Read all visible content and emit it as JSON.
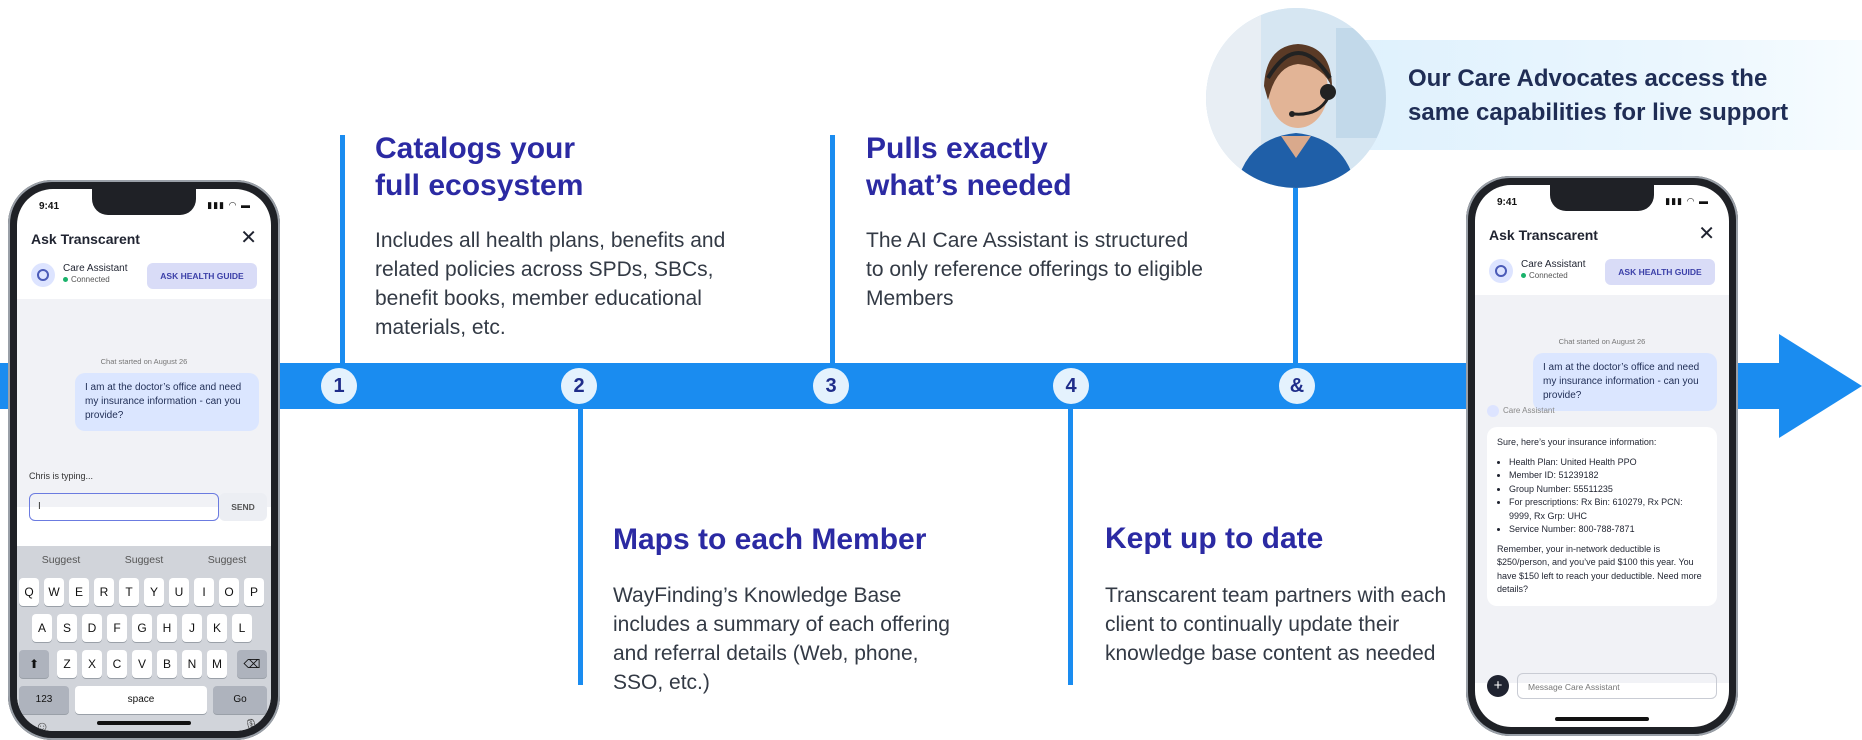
{
  "timeline": {
    "nodes": [
      "1",
      "2",
      "3",
      "4",
      "&"
    ]
  },
  "steps": [
    {
      "title_line1": "Catalogs your",
      "title_line2": "full ecosystem",
      "desc": "Includes all health plans, benefits and related policies across SPDs, SBCs, benefit books, member educational materials, etc."
    },
    {
      "title_line1": "Maps to each Member",
      "title_line2": "",
      "desc": "WayFinding’s Knowledge Base includes a summary of each offering and referral details (Web, phone, SSO, etc.)"
    },
    {
      "title_line1": "Pulls exactly",
      "title_line2": "what’s needed",
      "desc": "The AI Care Assistant is structured to only reference offerings to eligible Members"
    },
    {
      "title_line1": "Kept up to date",
      "title_line2": "",
      "desc": "Transcarent team partners with each client to continually update their knowledge base content as needed"
    }
  ],
  "advocate": {
    "text_line1": "Our Care Advocates access the",
    "text_line2": "same capabilities for live support"
  },
  "phone_left": {
    "time": "9:41",
    "header_title": "Ask Transcarent",
    "assistant_name": "Care Assistant",
    "assistant_status": "Connected",
    "guide_button": "ASK HEALTH GUIDE",
    "chat_started": "Chat started on August 26",
    "user_message": "I am at the doctor’s office and need my insurance information - can you provide?",
    "typing": "Chris is typing...",
    "input_value": "I",
    "send": "SEND",
    "suggestions": [
      "Suggest",
      "Suggest",
      "Suggest"
    ],
    "keys_row1": [
      "Q",
      "W",
      "E",
      "R",
      "T",
      "Y",
      "U",
      "I",
      "O",
      "P"
    ],
    "keys_row2": [
      "A",
      "S",
      "D",
      "F",
      "G",
      "H",
      "J",
      "K",
      "L"
    ],
    "keys_row3": [
      "Z",
      "X",
      "C",
      "V",
      "B",
      "N",
      "M"
    ],
    "key_numbers": "123",
    "key_space": "space",
    "key_go": "Go"
  },
  "phone_right": {
    "time": "9:41",
    "header_title": "Ask Transcarent",
    "assistant_name": "Care Assistant",
    "assistant_status": "Connected",
    "guide_button": "ASK HEALTH GUIDE",
    "chat_started": "Chat started on August 26",
    "user_message": "I am at the doctor’s office and need my insurance information - can you provide?",
    "assistant_label": "Care Assistant",
    "reply_intro": "Sure, here’s your insurance information:",
    "reply_items": [
      "Health Plan: United Health PPO",
      "Member ID: 51239182",
      "Group Number: 55511235",
      "For prescriptions: Rx Bin: 610279, Rx PCN: 9999, Rx Grp: UHC",
      "Service Number: 800-788-7871"
    ],
    "reply_outro": "Remember, your in-network deductible is $250/person, and you’ve paid $100 this year. You have $150 left to reach your deductible. Need more details?",
    "message_placeholder": "Message Care Assistant"
  }
}
